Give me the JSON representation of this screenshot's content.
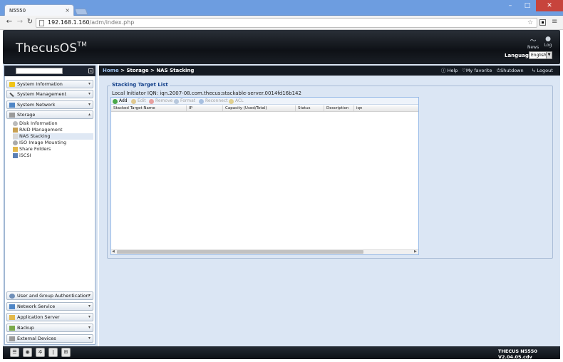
{
  "browser": {
    "tab_title": "N5550",
    "address_host": "192.168.1.160",
    "address_path": "/adm/index.php"
  },
  "header": {
    "logo": "ThecusOS",
    "logo_tm": "TM",
    "news_label": "News",
    "log_label": "Log",
    "language_label": "Language:",
    "language_value": "English"
  },
  "nav": {
    "categories_top": [
      {
        "label": "System Information",
        "icon": "info-icon"
      },
      {
        "label": "System Management",
        "icon": "tools-icon"
      },
      {
        "label": "System Network",
        "icon": "network-icon"
      },
      {
        "label": "Storage",
        "icon": "storage-icon"
      }
    ],
    "storage_items": [
      {
        "label": "Disk Information"
      },
      {
        "label": "RAID Management"
      },
      {
        "label": "NAS Stacking"
      },
      {
        "label": "ISO Image Mounting"
      },
      {
        "label": "Share Folders"
      },
      {
        "label": "iSCSI"
      }
    ],
    "categories_bottom": [
      {
        "label": "User and Group Authentication"
      },
      {
        "label": "Network Service"
      },
      {
        "label": "Application Server"
      },
      {
        "label": "Backup"
      },
      {
        "label": "External Devices"
      }
    ]
  },
  "breadcrumb": {
    "home": "Home",
    "rest": " > Storage > NAS Stacking"
  },
  "top_actions": {
    "help": "Help",
    "favorite": "My favorite",
    "shutdown": "Shutdown",
    "logout": "Logout"
  },
  "panel": {
    "legend": "Stacking Target List",
    "initiator": "Local Initiator IQN: iqn.2007-08.com.thecus:stackable-server.0014fd16b142",
    "toolbar": [
      "Add",
      "Edit",
      "Remove",
      "Format",
      "Reconnect",
      "ACL"
    ],
    "columns": [
      "Stacked Target Name",
      "IP",
      "Capacity (Used/Total)",
      "Status",
      "Description",
      "iqn"
    ]
  },
  "footer": {
    "version": "THECUS N5550 V2.04.05.cdv"
  },
  "colors": {
    "accent": "#15428b",
    "header_dark": "#0e1116",
    "content_bg": "#dbe6f4"
  }
}
